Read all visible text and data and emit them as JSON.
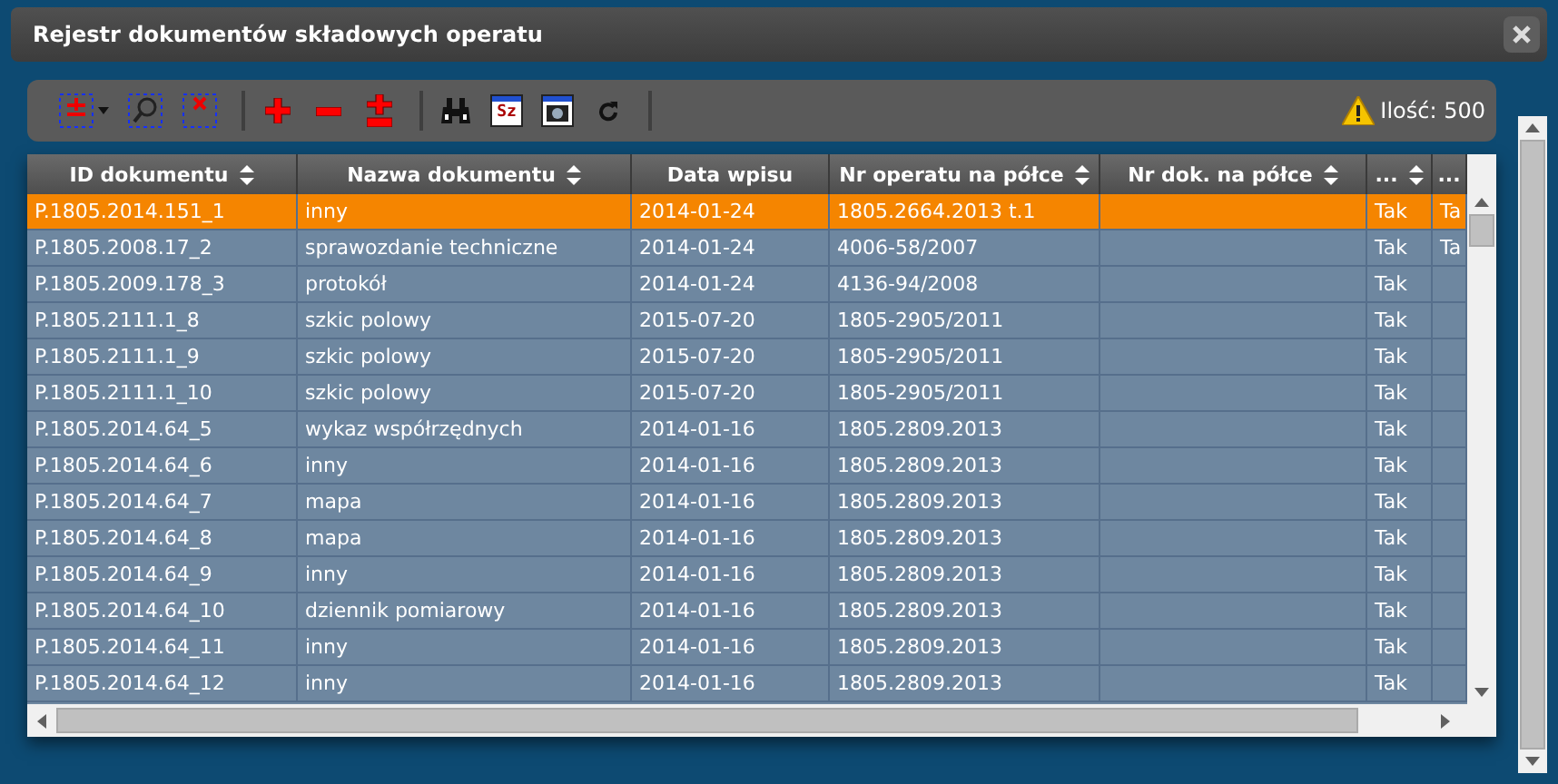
{
  "window": {
    "title": "Rejestr dokumentów składowych operatu"
  },
  "toolbar": {
    "groups": [
      [
        {
          "kind": "add-doc",
          "dropdown": true
        },
        {
          "kind": "find-doc"
        },
        {
          "kind": "delete-doc"
        }
      ],
      [
        {
          "kind": "plus"
        },
        {
          "kind": "minus"
        },
        {
          "kind": "plusminus"
        }
      ],
      [
        {
          "kind": "binoculars"
        },
        {
          "kind": "window",
          "label": "Sz"
        },
        {
          "kind": "camera"
        },
        {
          "kind": "refresh"
        }
      ]
    ],
    "count": "Ilość: 500"
  },
  "table": {
    "columns": [
      {
        "label": "ID dokumentu",
        "sortable": true
      },
      {
        "label": "Nazwa dokumentu",
        "sortable": true
      },
      {
        "label": "Data wpisu",
        "sortable": false
      },
      {
        "label": "Nr operatu na półce",
        "sortable": true
      },
      {
        "label": "Nr dok. na półce",
        "sortable": true
      },
      {
        "label": "...",
        "sortable": true
      },
      {
        "label": "...",
        "sortable": false
      }
    ],
    "rows": [
      {
        "selected": true,
        "cells": [
          "P.1805.2014.151_1",
          "inny",
          "2014-01-24",
          "1805.2664.2013 t.1",
          null,
          "Tak",
          "Ta"
        ]
      },
      {
        "selected": false,
        "cells": [
          "P.1805.2008.17_2",
          "sprawozdanie techniczne",
          "2014-01-24",
          "4006-58/2007",
          null,
          "Tak",
          "Ta"
        ]
      },
      {
        "selected": false,
        "cells": [
          "P.1805.2009.178_3",
          "protokół",
          "2014-01-24",
          "4136-94/2008",
          null,
          "Tak",
          null
        ]
      },
      {
        "selected": false,
        "cells": [
          "P.1805.2111.1_8",
          "szkic polowy",
          "2015-07-20",
          "1805-2905/2011",
          null,
          "Tak",
          null
        ]
      },
      {
        "selected": false,
        "cells": [
          "P.1805.2111.1_9",
          "szkic polowy",
          "2015-07-20",
          "1805-2905/2011",
          null,
          "Tak",
          null
        ]
      },
      {
        "selected": false,
        "cells": [
          "P.1805.2111.1_10",
          "szkic polowy",
          "2015-07-20",
          "1805-2905/2011",
          null,
          "Tak",
          null
        ]
      },
      {
        "selected": false,
        "cells": [
          "P.1805.2014.64_5",
          "wykaz współrzędnych",
          "2014-01-16",
          "1805.2809.2013",
          null,
          "Tak",
          null
        ]
      },
      {
        "selected": false,
        "cells": [
          "P.1805.2014.64_6",
          "inny",
          "2014-01-16",
          "1805.2809.2013",
          null,
          "Tak",
          null
        ]
      },
      {
        "selected": false,
        "cells": [
          "P.1805.2014.64_7",
          "mapa",
          "2014-01-16",
          "1805.2809.2013",
          null,
          "Tak",
          null
        ]
      },
      {
        "selected": false,
        "cells": [
          "P.1805.2014.64_8",
          "mapa",
          "2014-01-16",
          "1805.2809.2013",
          null,
          "Tak",
          null
        ]
      },
      {
        "selected": false,
        "cells": [
          "P.1805.2014.64_9",
          "inny",
          "2014-01-16",
          "1805.2809.2013",
          null,
          "Tak",
          null
        ]
      },
      {
        "selected": false,
        "cells": [
          "P.1805.2014.64_10",
          "dziennik pomiarowy",
          "2014-01-16",
          "1805.2809.2013",
          null,
          "Tak",
          null
        ]
      },
      {
        "selected": false,
        "cells": [
          "P.1805.2014.64_11",
          "inny",
          "2014-01-16",
          "1805.2809.2013",
          null,
          "Tak",
          null
        ]
      },
      {
        "selected": false,
        "cells": [
          "P.1805.2014.64_12",
          "inny",
          "2014-01-16",
          "1805.2809.2013",
          null,
          "Tak",
          null
        ]
      }
    ]
  }
}
